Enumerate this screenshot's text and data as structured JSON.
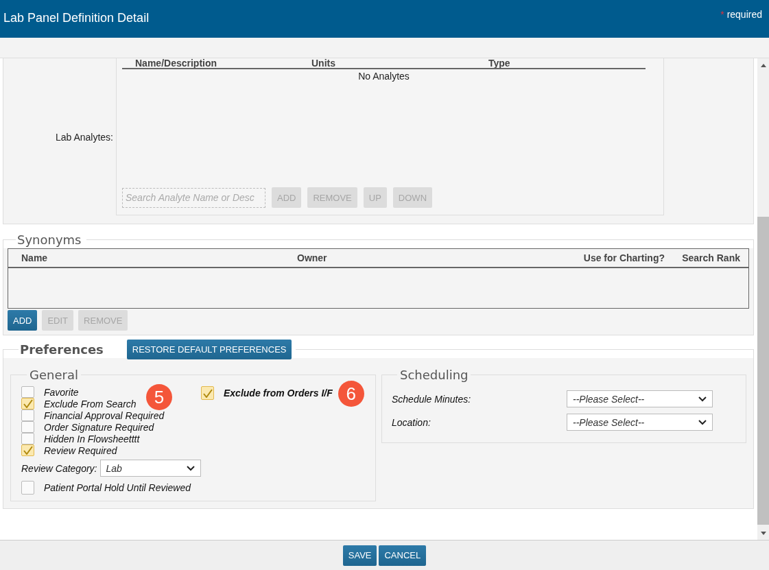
{
  "header": {
    "title": "Lab Panel Definition Detail",
    "required_mark": "*",
    "required_label": "required"
  },
  "lab_analytes": {
    "label": "Lab Analytes:",
    "columns": [
      "Name/Description",
      "Units",
      "Type"
    ],
    "empty_text": "No Analytes",
    "search": {
      "placeholder": "Search Analyte Name or Desc"
    },
    "buttons": [
      {
        "label": "ADD",
        "disabled": true
      },
      {
        "label": "REMOVE",
        "disabled": true
      },
      {
        "label": "UP",
        "disabled": true
      },
      {
        "label": "DOWN",
        "disabled": true
      }
    ]
  },
  "synonyms": {
    "title": "Synonyms",
    "columns": [
      "Name",
      "Owner",
      "Use for Charting?",
      "Search Rank"
    ],
    "buttons": [
      {
        "label": "ADD",
        "disabled": false
      },
      {
        "label": "EDIT",
        "disabled": true
      },
      {
        "label": "REMOVE",
        "disabled": true
      }
    ]
  },
  "preferences": {
    "title": "Preferences",
    "restore_button": "RESTORE DEFAULT PREFERENCES",
    "general": {
      "title": "General",
      "options": [
        {
          "label": "Favorite",
          "checked": false
        },
        {
          "label": "Exclude From Search",
          "checked": true,
          "callout": "5"
        },
        {
          "label": "Financial Approval Required",
          "checked": false
        },
        {
          "label": "Order Signature Required",
          "checked": false
        },
        {
          "label": "Hidden In Flowsheetttt",
          "checked": false
        },
        {
          "label": "Review Required",
          "checked": true
        }
      ],
      "review_category": {
        "label": "Review Category:",
        "value": "Lab"
      },
      "portal_hold": {
        "label": "Patient Portal Hold Until Reviewed",
        "checked": false
      },
      "exclude_orders": {
        "label": "Exclude from Orders I/F",
        "checked": true,
        "callout": "6"
      }
    },
    "scheduling": {
      "title": "Scheduling",
      "fields": [
        {
          "label": "Schedule Minutes:",
          "value": "--Please Select--"
        },
        {
          "label": "Location:",
          "value": "--Please Select--"
        }
      ]
    }
  },
  "footer": {
    "buttons": [
      {
        "label": "SAVE"
      },
      {
        "label": "CANCEL"
      }
    ]
  }
}
